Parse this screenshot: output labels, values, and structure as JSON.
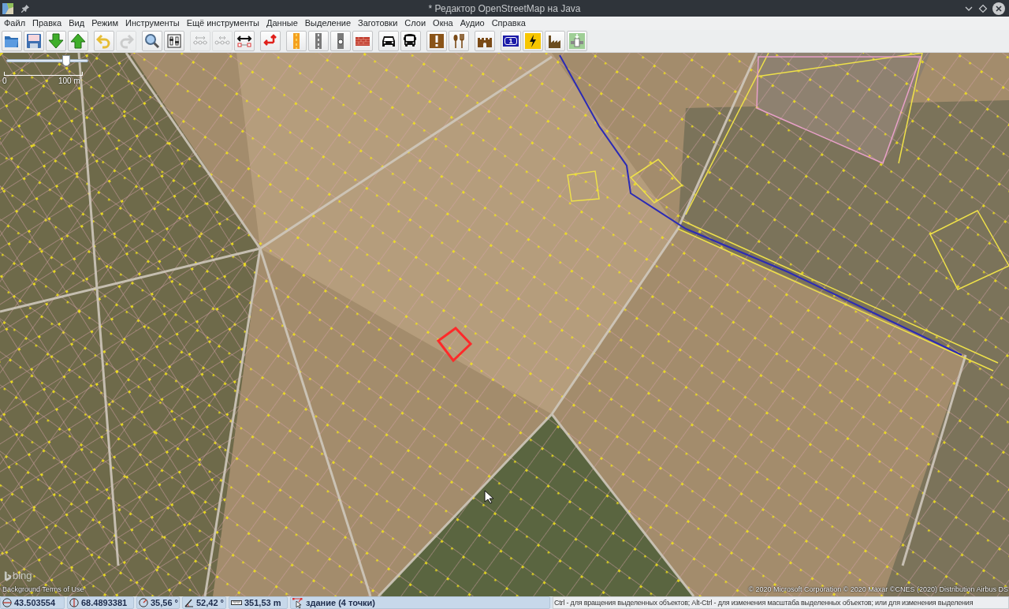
{
  "window": {
    "title": "* Редактор OpenStreetMap на Java"
  },
  "menu": [
    "Файл",
    "Правка",
    "Вид",
    "Режим",
    "Инструменты",
    "Ещё инструменты",
    "Данные",
    "Выделение",
    "Заготовки",
    "Слои",
    "Окна",
    "Аудио",
    "Справка"
  ],
  "toolbar": [
    [
      {
        "kind": "open",
        "disabled": false
      },
      {
        "kind": "save",
        "disabled": false
      },
      {
        "kind": "download",
        "disabled": false
      },
      {
        "kind": "upload",
        "disabled": false
      }
    ],
    [
      {
        "kind": "undo",
        "disabled": false
      },
      {
        "kind": "redo",
        "disabled": true
      }
    ],
    [
      {
        "kind": "zoom",
        "disabled": false
      },
      {
        "kind": "preferences",
        "disabled": false
      }
    ],
    [
      {
        "kind": "align_line",
        "disabled": true
      },
      {
        "kind": "align_circle",
        "disabled": true
      },
      {
        "kind": "resize",
        "disabled": false
      }
    ],
    [
      {
        "kind": "move",
        "disabled": false
      }
    ],
    [
      {
        "kind": "road_primary",
        "disabled": false
      },
      {
        "kind": "road",
        "disabled": false
      },
      {
        "kind": "road_turning",
        "disabled": false
      },
      {
        "kind": "wall",
        "disabled": false
      }
    ],
    [
      {
        "kind": "car",
        "disabled": false
      },
      {
        "kind": "bus",
        "disabled": false
      }
    ],
    [
      {
        "kind": "warning",
        "disabled": false
      },
      {
        "kind": "restaurant",
        "disabled": false
      }
    ],
    [
      {
        "kind": "castle",
        "disabled": false
      }
    ],
    [
      {
        "kind": "route",
        "label": "1",
        "disabled": false
      },
      {
        "kind": "power",
        "disabled": false
      },
      {
        "kind": "factory",
        "disabled": false
      },
      {
        "kind": "pipeline",
        "disabled": false
      }
    ]
  ],
  "map": {
    "zoom_slider": {
      "level": 0.73
    },
    "scale": {
      "start": "0",
      "end": "100 m"
    },
    "imagery_logo": "bing",
    "terms_link": "Background Terms of Use",
    "attribution": "© 2020 Microsoft Corporation © 2020 Maxar ©CNES (2020) Distribution Airbus DS",
    "building": {
      "selected": true
    }
  },
  "status_bar": {
    "fields": [
      {
        "kind": "latitude",
        "value": "43.503554"
      },
      {
        "kind": "longitude",
        "value": "68.4893381"
      },
      {
        "kind": "heading",
        "value": "35,56 °"
      },
      {
        "kind": "angle",
        "value": "52,42 °"
      },
      {
        "kind": "distance",
        "value": "351,53 m"
      },
      {
        "kind": "selection",
        "value": "здание (4 точки)"
      }
    ],
    "help": "Ctrl - для вращения выделенных объектов; Alt-Ctrl - для изменения масштаба выделенных объектов; или для изменения выделения"
  }
}
